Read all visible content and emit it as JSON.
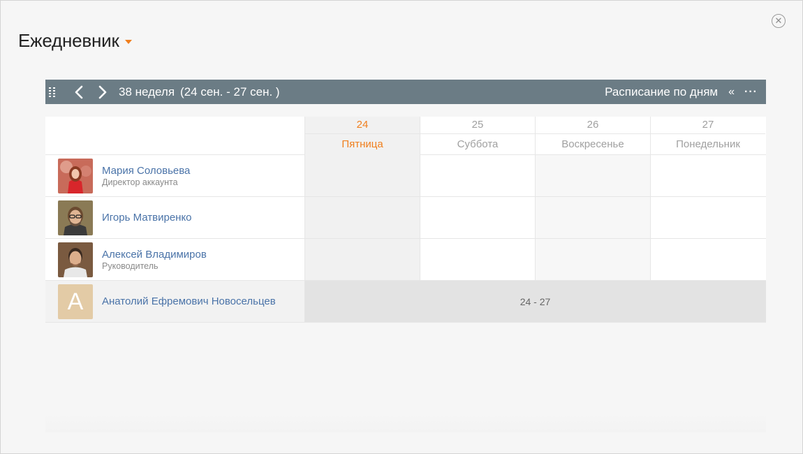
{
  "window": {
    "close_icon": "close-circle-icon"
  },
  "app": {
    "title": "Ежедневник"
  },
  "toolbar": {
    "week_label": "38 неделя",
    "week_range": "(24 сен. - 27 сен. )",
    "view_mode": "Расписание по дням",
    "collapse_glyph": "«",
    "more_glyph": "···",
    "background": "#6b7c85"
  },
  "days": [
    {
      "num": "24",
      "name": "Пятница",
      "today": true
    },
    {
      "num": "25",
      "name": "Суббота",
      "today": false
    },
    {
      "num": "26",
      "name": "Воскресенье",
      "today": false
    },
    {
      "num": "27",
      "name": "Понедельник",
      "today": false
    }
  ],
  "people": [
    {
      "name": "Мария Соловьева",
      "role": "Директор аккаунта"
    },
    {
      "name": "Игорь Матвиренко",
      "role": ""
    },
    {
      "name": "Алексей Владимиров",
      "role": "Руководитель"
    },
    {
      "name": "Анатолий Ефремович Новосельцев",
      "role": "",
      "initial": "А",
      "span_label": "24 - 27"
    }
  ],
  "colors": {
    "accent": "#f07f1e",
    "link": "#4a73a8"
  }
}
